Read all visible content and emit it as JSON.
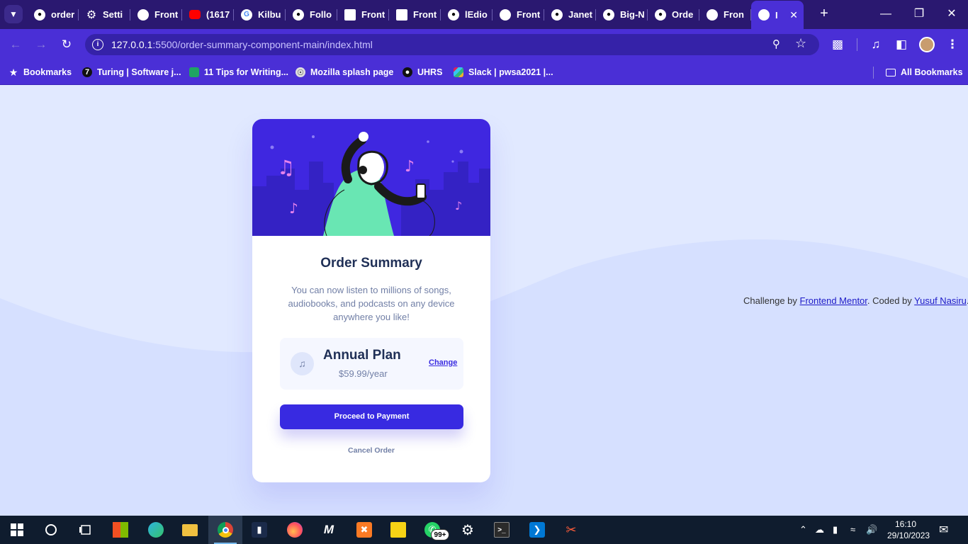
{
  "browser": {
    "tabs": [
      {
        "label": "order",
        "favicon": "github-icon"
      },
      {
        "label": "Setti",
        "favicon": "gear-icon"
      },
      {
        "label": "Front",
        "favicon": "frontend-mentor-icon"
      },
      {
        "label": "(1617",
        "favicon": "youtube-icon"
      },
      {
        "label": "Kilbu",
        "favicon": "google-icon"
      },
      {
        "label": "Follo",
        "favicon": "github-icon"
      },
      {
        "label": "Front",
        "favicon": "document-icon"
      },
      {
        "label": "Front",
        "favicon": "document-icon"
      },
      {
        "label": "lEdio",
        "favicon": "github-icon"
      },
      {
        "label": "Front",
        "favicon": "frontend-mentor-icon"
      },
      {
        "label": "Janet",
        "favicon": "github-icon"
      },
      {
        "label": "Big-N",
        "favicon": "github-icon"
      },
      {
        "label": "Orde",
        "favicon": "github-icon"
      },
      {
        "label": "Fron",
        "favicon": "frontend-mentor-icon"
      },
      {
        "label": "I",
        "favicon": "frontend-mentor-icon",
        "active": true
      }
    ],
    "url": {
      "host": "127.0.0.1",
      "path": ":5500/order-summary-component-main/index.html"
    },
    "bookmarks": [
      {
        "label": "Bookmarks",
        "icon": "star-icon"
      },
      {
        "label": "Turing | Software j...",
        "icon": "turing-icon"
      },
      {
        "label": "11 Tips for Writing...",
        "icon": "page-icon"
      },
      {
        "label": "Mozilla splash page",
        "icon": "globe-icon"
      },
      {
        "label": "UHRS",
        "icon": "uhrs-icon"
      },
      {
        "label": "Slack | pwsa2021 |...",
        "icon": "slack-icon"
      }
    ],
    "all_bookmarks": "All Bookmarks"
  },
  "card": {
    "title": "Order Summary",
    "description": "You can now listen to millions of songs, audiobooks, and podcasts on any device anywhere you like!",
    "plan": {
      "name": "Annual Plan",
      "price": "$59.99/year",
      "change_label": "Change"
    },
    "pay_label": "Proceed to Payment",
    "cancel_label": "Cancel Order"
  },
  "attribution": {
    "prefix": "Challenge by",
    "link1": "Frontend Mentor",
    "middle": ". Coded by",
    "link2": "Yusuf Nasiru",
    "suffix": "."
  },
  "taskbar": {
    "apps": [
      "start",
      "search",
      "task-view",
      "store",
      "edge",
      "file-explorer",
      "chrome",
      "app-dark",
      "firefox",
      "app-m",
      "xampp",
      "sticky-notes",
      "whatsapp",
      "settings",
      "terminal",
      "vscode",
      "snipping-tool"
    ],
    "whatsapp_badge": "99+",
    "time": "16:10",
    "date": "29/10/2023"
  },
  "colors": {
    "tab_strip": "#2a1870",
    "toolbar": "#4a2fd6",
    "page_bg": "#e1e9ff",
    "wave": "#d6e0ff",
    "accent": "#382ae1",
    "title": "#1f2f56",
    "muted": "#717fa6"
  }
}
